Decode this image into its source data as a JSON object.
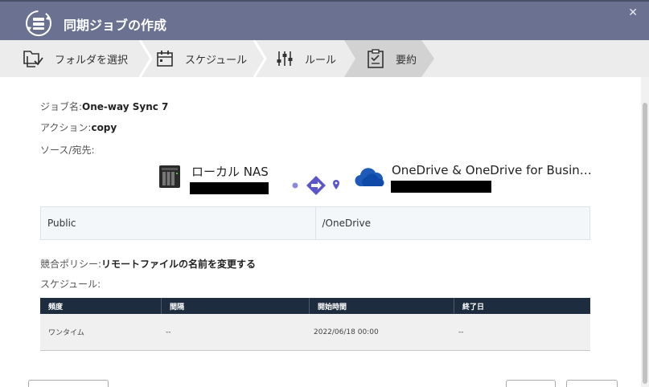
{
  "window": {
    "title": "同期ジョブの作成",
    "close_glyph": "✕"
  },
  "steps": [
    {
      "label": "フォルダを選択",
      "icon": "folder-select-icon"
    },
    {
      "label": "スケジュール",
      "icon": "calendar-icon"
    },
    {
      "label": "ルール",
      "icon": "sliders-icon"
    },
    {
      "label": "要約",
      "icon": "clipboard-icon",
      "active": true
    }
  ],
  "summary": {
    "job_name_label": "ジョブ名:",
    "job_name_value": "One-way Sync 7",
    "action_label": "アクション:",
    "action_value": "copy",
    "source_dest_label": "ソース/宛先:",
    "source_name": "ローカル NAS",
    "destination_name": "OneDrive & OneDrive for Busin…",
    "source_path": "Public",
    "destination_path": "/OneDrive",
    "conflict_label": "競合ポリシー:",
    "conflict_value": "リモートファイルの名前を変更する",
    "schedule_label": "スケジュール:"
  },
  "schedule_table": {
    "headers": [
      "頻度",
      "間隔",
      "開始時間",
      "終了日"
    ],
    "rows": [
      [
        "ワンタイム",
        "--",
        "2022/06/18 00:00",
        "--"
      ]
    ]
  },
  "colors": {
    "titlebar": "#6b7191",
    "table_header": "#1d2d3f",
    "flow_accent": "#5b55c8",
    "onedrive_blue": "#1e5bb8"
  }
}
